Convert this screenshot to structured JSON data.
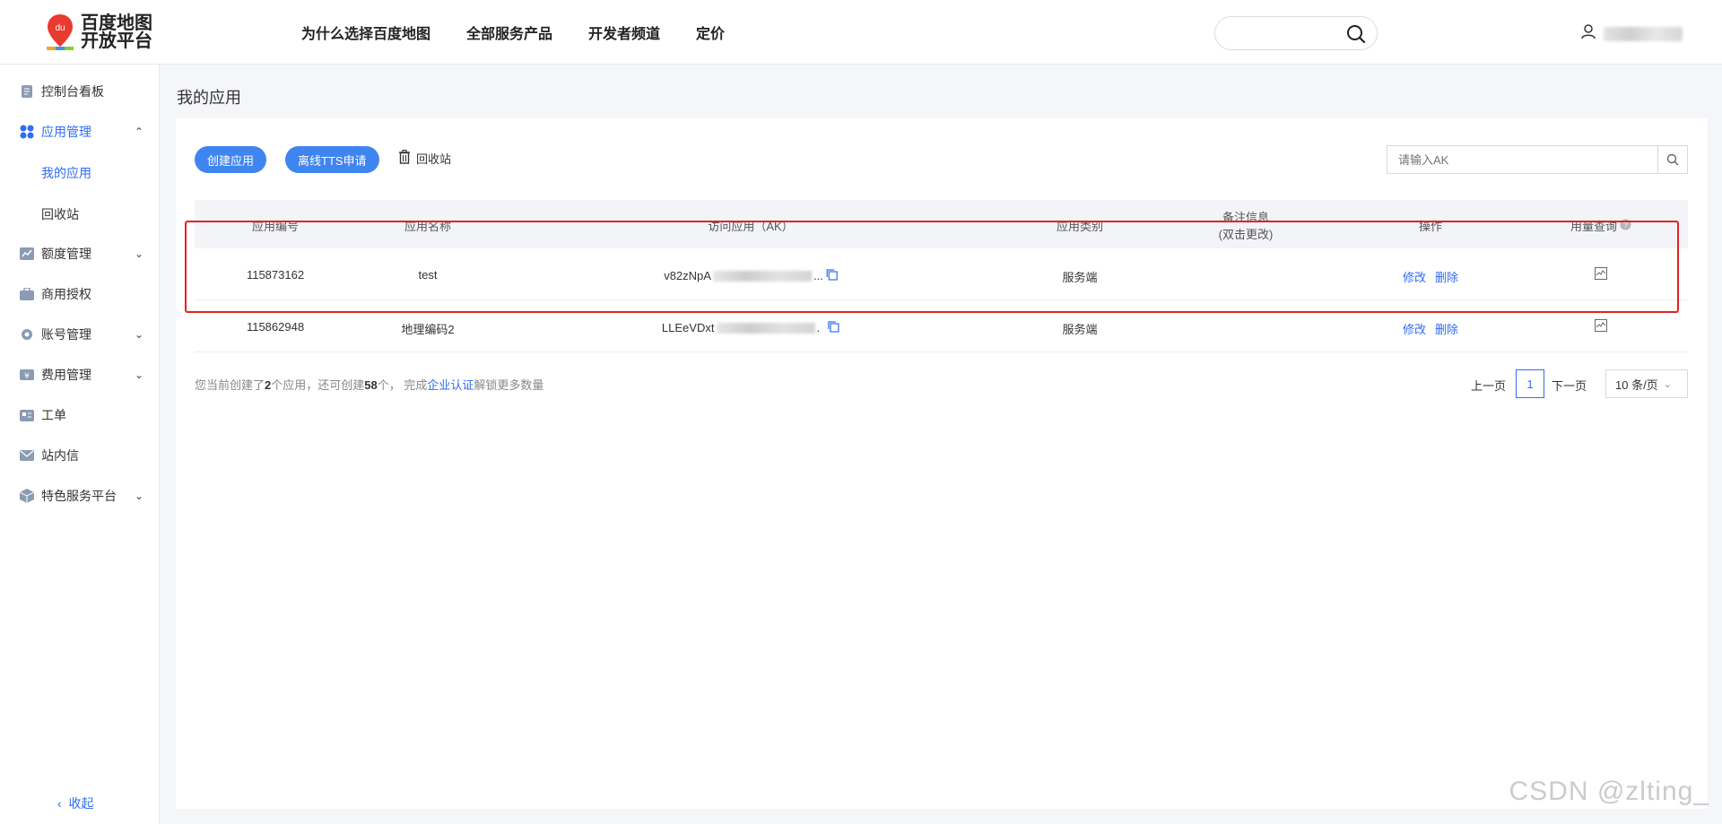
{
  "brand": {
    "logo_line1": "百度地图",
    "logo_line2": "开放平台",
    "logo_badge": "du"
  },
  "nav": [
    "为什么选择百度地图",
    "全部服务产品",
    "开发者频道",
    "定价"
  ],
  "header": {
    "search_placeholder": ""
  },
  "sidebar": {
    "items": [
      {
        "label": "控制台看板",
        "icon": "dashboard-doc-icon"
      },
      {
        "label": "应用管理",
        "icon": "apps-icon",
        "expanded": true
      },
      {
        "label": "额度管理",
        "icon": "quota-chart-icon"
      },
      {
        "label": "商用授权",
        "icon": "briefcase-icon"
      },
      {
        "label": "账号管理",
        "icon": "gear-icon"
      },
      {
        "label": "费用管理",
        "icon": "wallet-icon"
      },
      {
        "label": "工单",
        "icon": "ticket-card-icon"
      },
      {
        "label": "站内信",
        "icon": "mail-icon"
      },
      {
        "label": "特色服务平台",
        "icon": "cube-icon"
      }
    ],
    "sub_items": [
      "我的应用",
      "回收站"
    ],
    "collapse_label": "收起"
  },
  "page": {
    "title": "我的应用",
    "create_button": "创建应用",
    "tts_button": "离线TTS申请",
    "recycle_label": "回收站",
    "ak_placeholder": "请输入AK"
  },
  "table": {
    "headers": {
      "id": "应用编号",
      "name": "应用名称",
      "ak": "访问应用（AK）",
      "type": "应用类别",
      "remark_line1": "备注信息",
      "remark_line2": "(双击更改)",
      "actions": "操作",
      "usage": "用量查询"
    },
    "rows": [
      {
        "id": "115873162",
        "name": "test",
        "ak_prefix": "v82zNpA",
        "ak_suffix": "...",
        "type": "服务端",
        "edit": "修改",
        "delete": "删除"
      },
      {
        "id": "115862948",
        "name": "地理编码2",
        "ak_prefix": "LLEeVDxt",
        "ak_suffix": ".",
        "type": "服务端",
        "edit": "修改",
        "delete": "删除"
      }
    ]
  },
  "footer": {
    "text1": "您当前创建了",
    "created_count": "2",
    "text2": "个应用，还可创建",
    "remaining_count": "58",
    "text3": "个，  完成",
    "link": "企业认证",
    "text4": "解锁更多数量"
  },
  "pagination": {
    "prev": "上一页",
    "current": "1",
    "next": "下一页",
    "page_size": "10 条/页"
  },
  "watermark": "CSDN @zlting_",
  "colors": {
    "accent": "#2e6cf6",
    "primary_button": "#3f85f0",
    "highlight_box": "#e8211f"
  }
}
